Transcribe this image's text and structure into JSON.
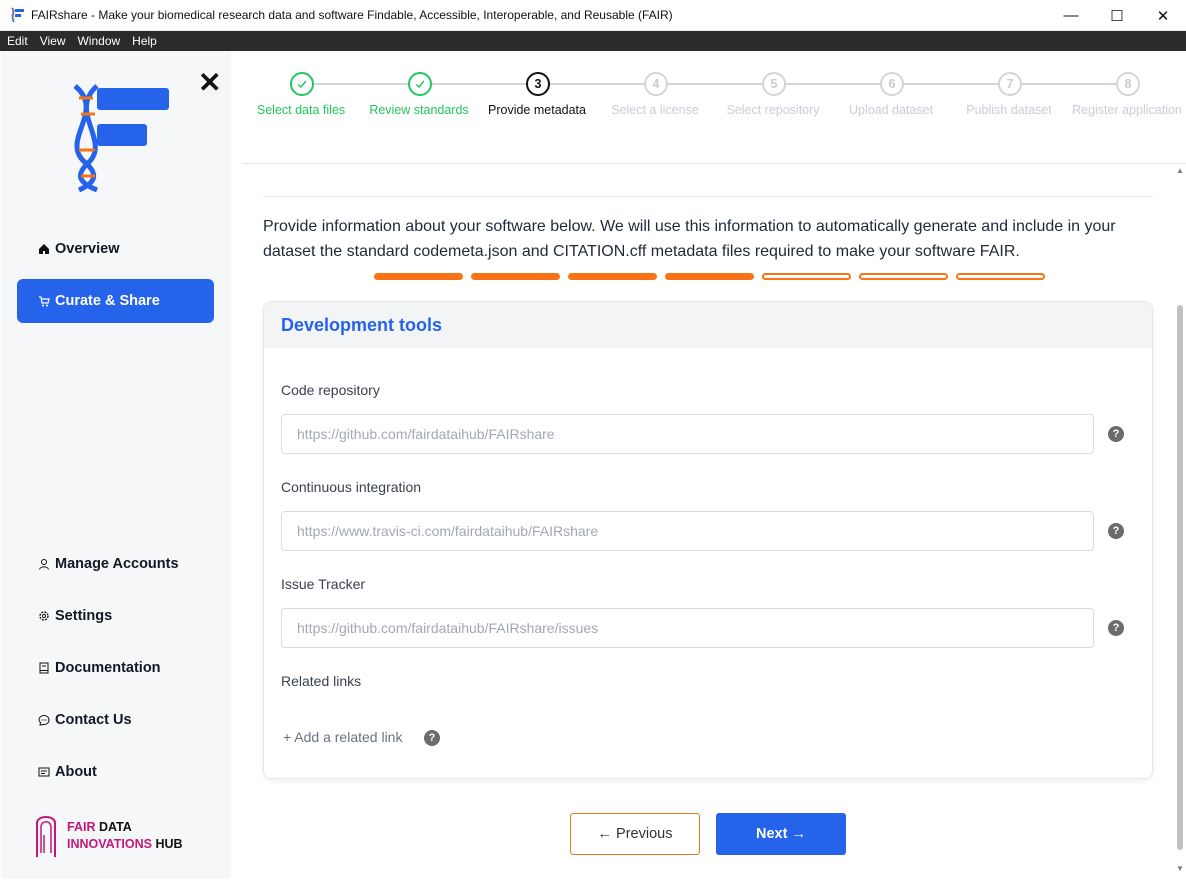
{
  "window": {
    "title": "FAIRshare - Make your biomedical research data and software Findable, Accessible, Interoperable, and Reusable (FAIR)",
    "controls": {
      "minimize": "—",
      "maximize": "☐",
      "close": "✕"
    }
  },
  "menu": [
    "Edit",
    "View",
    "Window",
    "Help"
  ],
  "sidebar": {
    "close": "✕",
    "nav_top": [
      {
        "label": "Overview",
        "icon": "home-icon"
      },
      {
        "label": "Curate & Share",
        "icon": "cart-icon",
        "active": true
      }
    ],
    "nav_bottom": [
      {
        "label": "Manage Accounts",
        "icon": "user-icon"
      },
      {
        "label": "Settings",
        "icon": "gear-icon"
      },
      {
        "label": "Documentation",
        "icon": "book-icon"
      },
      {
        "label": "Contact Us",
        "icon": "chat-icon"
      },
      {
        "label": "About",
        "icon": "info-card-icon"
      }
    ],
    "brand": {
      "line1_a": "FAIR",
      "line1_b": "DATA",
      "line2_a": "INNOVATIONS",
      "line2_b": "HUB"
    }
  },
  "stepper": {
    "steps": [
      {
        "num": "",
        "label": "Select data files",
        "state": "done"
      },
      {
        "num": "",
        "label": "Review standards",
        "state": "done"
      },
      {
        "num": "3",
        "label": "Provide metadata",
        "state": "current"
      },
      {
        "num": "4",
        "label": "Select a license",
        "state": "todo"
      },
      {
        "num": "5",
        "label": "Select repository",
        "state": "todo"
      },
      {
        "num": "6",
        "label": "Upload dataset",
        "state": "todo"
      },
      {
        "num": "7",
        "label": "Publish dataset",
        "state": "todo"
      },
      {
        "num": "8",
        "label": "Register application",
        "state": "todo"
      }
    ]
  },
  "intro": "Provide information about your software below. We will use this information to automatically generate and include in your dataset the standard codemeta.json and CITATION.cff metadata files required to make your software FAIR.",
  "form_progress": {
    "total": 7,
    "completed": 4,
    "color": "#f97316"
  },
  "card": {
    "title": "Development tools",
    "fields": {
      "code_repo": {
        "label": "Code repository",
        "placeholder": "https://github.com/fairdataihub/FAIRshare",
        "value": ""
      },
      "ci": {
        "label": "Continuous integration",
        "placeholder": "https://www.travis-ci.com/fairdataihub/FAIRshare",
        "value": ""
      },
      "issues": {
        "label": "Issue Tracker",
        "placeholder": "https://github.com/fairdataihub/FAIRshare/issues",
        "value": ""
      }
    },
    "related_links_label": "Related links",
    "add_related_link": "+ Add a related link",
    "help": "?"
  },
  "buttons": {
    "previous": "← Previous",
    "next": "Next →"
  },
  "colors": {
    "accent": "#2563eb",
    "done": "#22c55e",
    "orange": "#f97316",
    "brand_pink": "#c2187a"
  }
}
